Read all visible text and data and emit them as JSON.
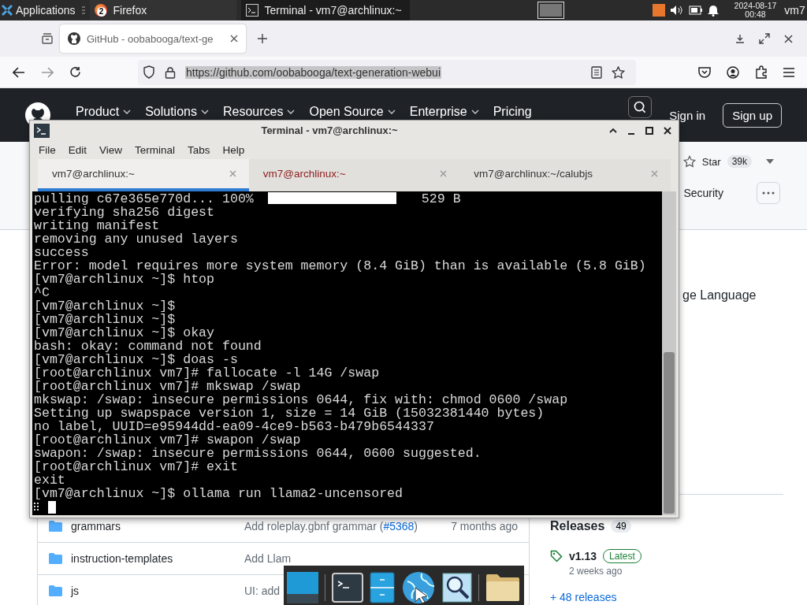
{
  "taskbar": {
    "apps_menu": "Applications",
    "windows": [
      {
        "label": "Firefox",
        "badge": "2",
        "selected": false
      },
      {
        "label": "Terminal - vm7@archlinux:~",
        "selected": true
      }
    ],
    "clock": {
      "date": "2024-08-17",
      "time": "00:48"
    },
    "user": "vm7"
  },
  "browser": {
    "tabs": [
      {
        "label": "GitHub - oobabooga/text-ge",
        "selected": true
      }
    ],
    "url": "https://github.com/oobabooga/text-generation-webui",
    "url_selected": true
  },
  "github": {
    "nav": [
      "Product",
      "Solutions",
      "Resources",
      "Open Source",
      "Enterprise",
      "Pricing"
    ],
    "sign_in": "Sign in",
    "sign_up": "Sign up",
    "star": {
      "label": "Star",
      "count": "39k"
    },
    "repo_tab": "Security",
    "about_text": "ge Language",
    "files": [
      {
        "name": "grammars",
        "message": "Add roleplay.gbnf grammar (",
        "link": "#5368",
        "message_end": ")",
        "time": "7 months ago"
      },
      {
        "name": "instruction-templates",
        "message": "Add Llam"
      },
      {
        "name": "js",
        "message": "UI: add"
      }
    ],
    "releases": {
      "title": "Releases",
      "count": "49",
      "version": "v1.13",
      "badge": "Latest",
      "date": "2 weeks ago",
      "more": "+ 48 releases"
    }
  },
  "terminal": {
    "title": "Terminal - vm7@archlinux:~",
    "menu": [
      "File",
      "Edit",
      "View",
      "Terminal",
      "Tabs",
      "Help"
    ],
    "tabs": [
      {
        "label": "vm7@archlinux:~",
        "selected": true,
        "attention": false
      },
      {
        "label": "vm7@archlinux:~",
        "selected": false,
        "attention": true
      },
      {
        "label": "vm7@archlinux:~/calubjs",
        "selected": false,
        "attention": false
      }
    ],
    "progress": {
      "prefix": "pulling c67e365e770d... 100%",
      "level": 1,
      "suffix": "529 B"
    },
    "lines": [
      "verifying sha256 digest",
      "writing manifest",
      "removing any unused layers",
      "success",
      "Error: model requires more system memory (8.4 GiB) than is available (5.8 GiB)",
      "[vm7@archlinux ~]$ htop",
      "^C",
      "[vm7@archlinux ~]$",
      "[vm7@archlinux ~]$",
      "[vm7@archlinux ~]$ okay",
      "bash: okay: command not found",
      "[vm7@archlinux ~]$ doas -s",
      "[root@archlinux vm7]# fallocate -l 14G /swap",
      "[root@archlinux vm7]# mkswap /swap",
      "mkswap: /swap: insecure permissions 0644, fix with: chmod 0600 /swap",
      "Setting up swapspace version 1, size = 14 GiB (15032381440 bytes)",
      "no label, UUID=e95944dd-ea09-4ce9-b563-b479b6544337",
      "[root@archlinux vm7]# swapon /swap",
      "swapon: /swap: insecure permissions 0644, 0600 suggested.",
      "[root@archlinux vm7]# exit",
      "exit",
      "[vm7@archlinux ~]$ ollama run llama2-uncensored"
    ]
  }
}
